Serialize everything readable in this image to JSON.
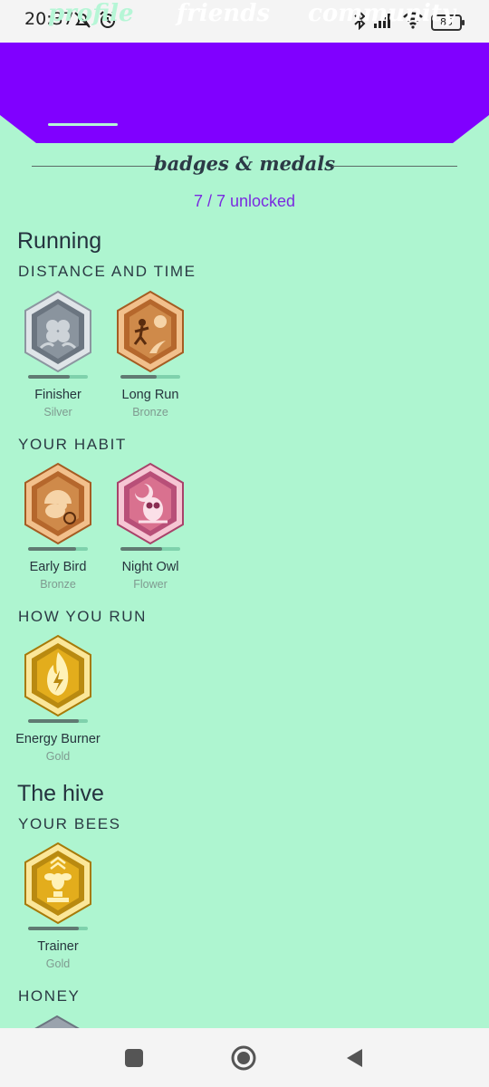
{
  "status": {
    "time": "20:37",
    "battery": "85"
  },
  "tabs": [
    {
      "label": "profile",
      "active": true
    },
    {
      "label": "friends",
      "active": false
    },
    {
      "label": "community",
      "active": false
    }
  ],
  "section_title": "badges & medals",
  "unlocked_text": "7 / 7 unlocked",
  "groups": [
    {
      "title": "Running",
      "subsections": [
        {
          "heading": "DISTANCE AND TIME",
          "badges": [
            {
              "name": "Finisher",
              "tier": "Silver",
              "progress": 0.7,
              "icon": "clover-medal-icon"
            },
            {
              "name": "Long Run",
              "tier": "Bronze",
              "progress": 0.6,
              "icon": "runner-medal-icon"
            }
          ]
        },
        {
          "heading": "YOUR HABIT",
          "badges": [
            {
              "name": "Early Bird",
              "tier": "Bronze",
              "progress": 0.8,
              "icon": "bird-sunrise-medal-icon"
            },
            {
              "name": "Night Owl",
              "tier": "Flower",
              "progress": 0.7,
              "icon": "owl-moon-medal-icon"
            }
          ]
        },
        {
          "heading": "HOW YOU RUN",
          "badges": [
            {
              "name": "Energy Burner",
              "tier": "Gold",
              "progress": 0.85,
              "icon": "flame-bolt-medal-icon"
            }
          ]
        }
      ]
    },
    {
      "title": "The hive",
      "subsections": [
        {
          "heading": "YOUR BEES",
          "badges": [
            {
              "name": "Trainer",
              "tier": "Gold",
              "progress": 0.85,
              "icon": "bee-trophy-medal-icon"
            }
          ]
        },
        {
          "heading": "HONEY",
          "badges": []
        }
      ]
    }
  ],
  "colors": {
    "background": "#aef5d0",
    "header": "#8000ff",
    "accent_text": "#7a2be0",
    "silver": "#9aa3ad",
    "bronze": "#c8783a",
    "flower": "#d9718f",
    "gold": "#e3ad1c"
  }
}
